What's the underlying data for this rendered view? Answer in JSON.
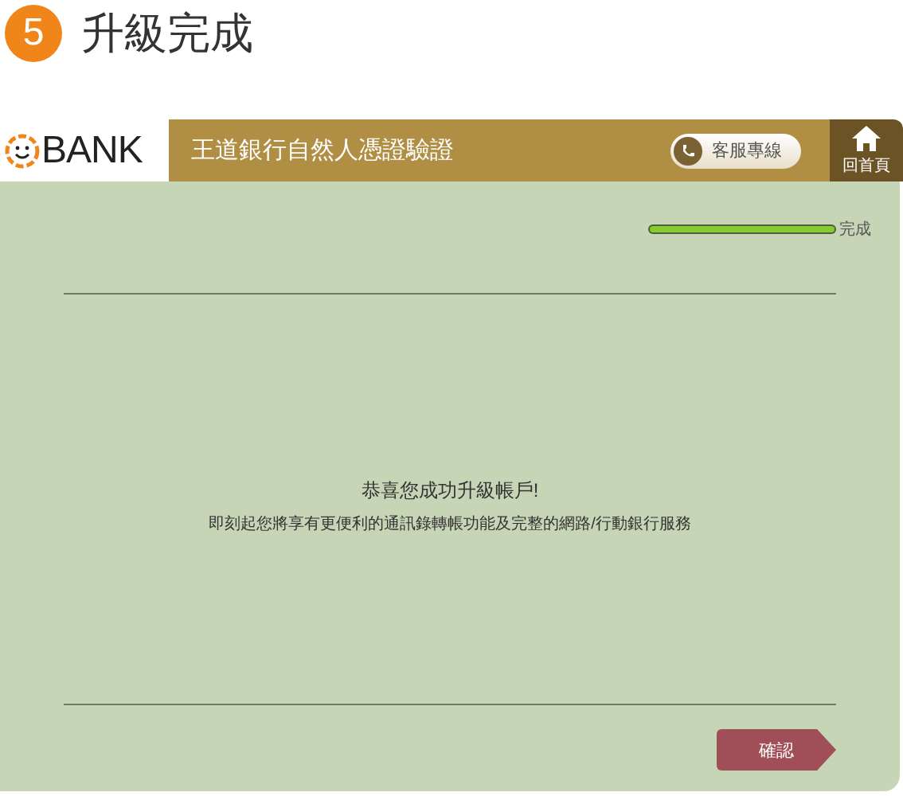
{
  "step": {
    "number": "5",
    "title": "升級完成"
  },
  "header": {
    "logo": "BANK",
    "title": "王道銀行自然人憑證驗證",
    "service_button": "客服專線",
    "home_button": "回首頁"
  },
  "progress": {
    "level": 1,
    "label": "完成"
  },
  "message": {
    "title": "恭喜您成功升級帳戶!",
    "body": "即刻起您將享有更便利的通訊錄轉帳功能及完整的網路/行動銀行服務"
  },
  "buttons": [
    "確認"
  ]
}
